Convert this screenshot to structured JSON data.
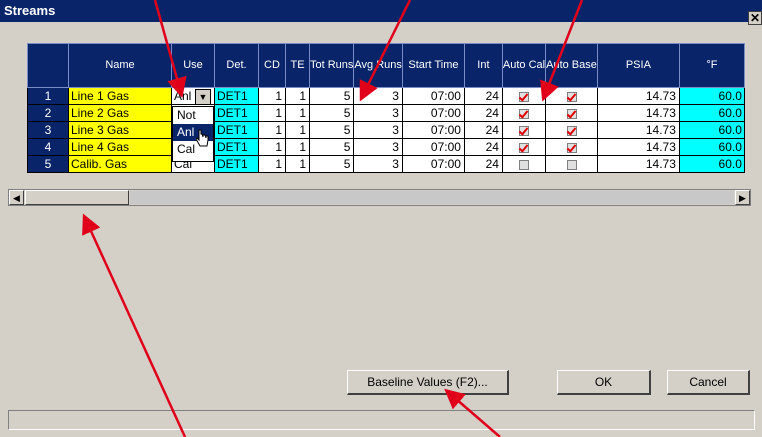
{
  "window": {
    "title": "Streams",
    "close_glyph": "✕"
  },
  "grid": {
    "headers": [
      "",
      "Name",
      "Use",
      "Det.",
      "CD",
      "TE",
      "Tot Runs",
      "Avg Runs",
      "Start Time",
      "Int",
      "Auto Cal",
      "Auto Base",
      "PSIA",
      "°F"
    ],
    "rows": [
      {
        "num": "1",
        "name": "Line 1 Gas",
        "use": "Anl",
        "det": "DET1",
        "cd": "1",
        "te": "1",
        "tot": "5",
        "avg": "3",
        "start": "07:00",
        "int": "24",
        "auto_cal": true,
        "auto_base": true,
        "psia": "14.73",
        "temp": "60.0"
      },
      {
        "num": "2",
        "name": "Line 2 Gas",
        "use": "Anl",
        "det": "DET1",
        "cd": "1",
        "te": "1",
        "tot": "5",
        "avg": "3",
        "start": "07:00",
        "int": "24",
        "auto_cal": true,
        "auto_base": true,
        "psia": "14.73",
        "temp": "60.0"
      },
      {
        "num": "3",
        "name": "Line 3 Gas",
        "use": "Anl",
        "det": "DET1",
        "cd": "1",
        "te": "1",
        "tot": "5",
        "avg": "3",
        "start": "07:00",
        "int": "24",
        "auto_cal": true,
        "auto_base": true,
        "psia": "14.73",
        "temp": "60.0"
      },
      {
        "num": "4",
        "name": "Line 4 Gas",
        "use": "Anl",
        "det": "DET1",
        "cd": "1",
        "te": "1",
        "tot": "5",
        "avg": "3",
        "start": "07:00",
        "int": "24",
        "auto_cal": true,
        "auto_base": true,
        "psia": "14.73",
        "temp": "60.0"
      },
      {
        "num": "5",
        "name": "Calib. Gas",
        "use": "Cal",
        "det": "DET1",
        "cd": "1",
        "te": "1",
        "tot": "5",
        "avg": "3",
        "start": "07:00",
        "int": "24",
        "auto_cal": false,
        "auto_base": false,
        "psia": "14.73",
        "temp": "60.0"
      }
    ],
    "dropdown_options": [
      "Not",
      "Anl",
      "Cal"
    ],
    "dropdown_selected": "Anl"
  },
  "buttons": {
    "baseline": "Baseline Values (F2)...",
    "ok": "OK",
    "cancel": "Cancel"
  },
  "colors": {
    "header_bg": "#0a246a",
    "name_bg": "#ffff00",
    "det_bg": "#00ffff",
    "arrow": "#e0001a"
  }
}
